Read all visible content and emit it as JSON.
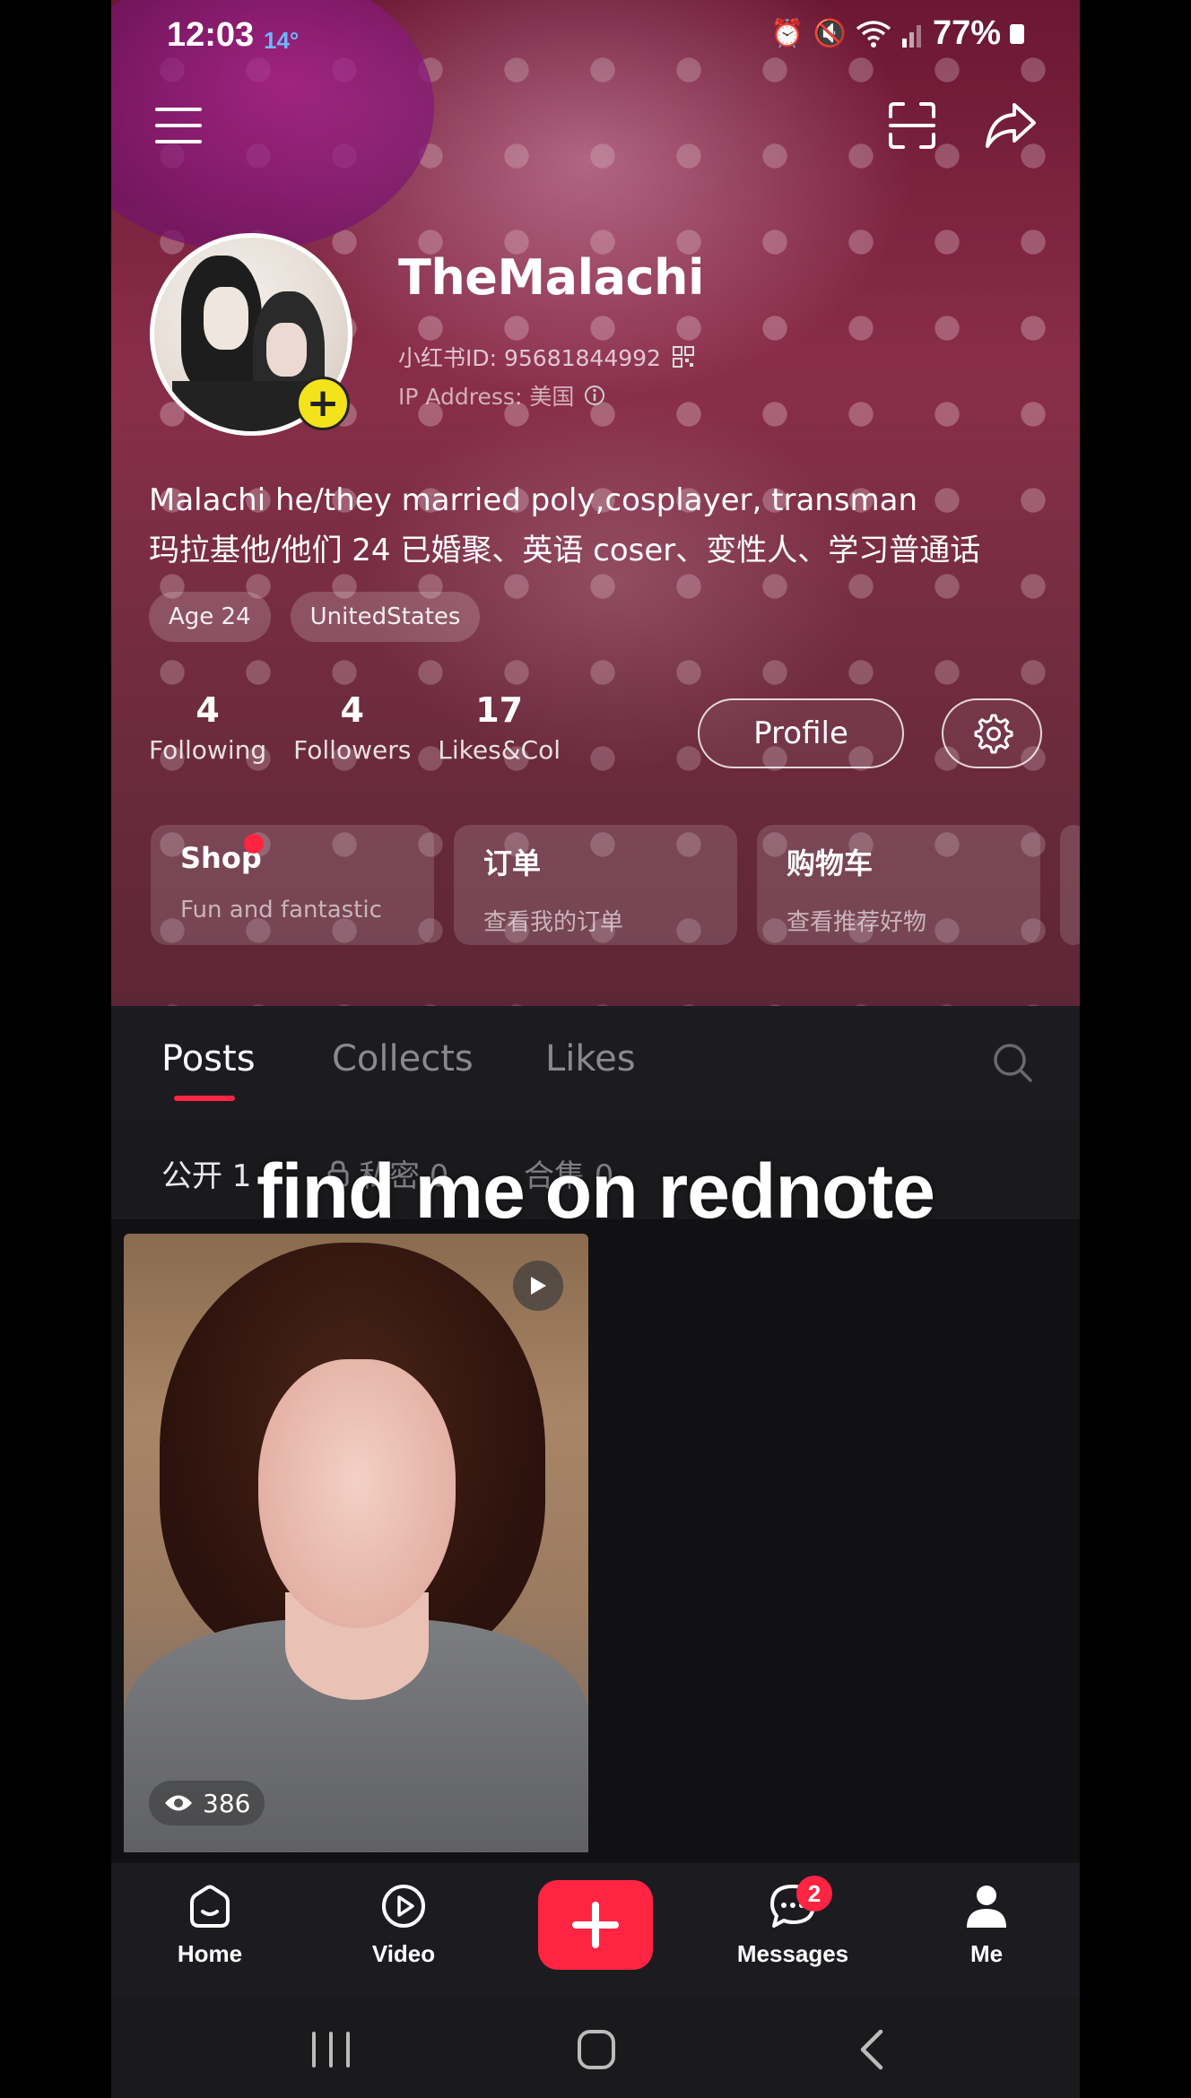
{
  "status": {
    "time": "12:03",
    "temp": "14°",
    "battery": "77%"
  },
  "profile": {
    "name": "TheMalachi",
    "id_text": "小红书ID: 95681844992",
    "ip_text": "IP Address: 美国",
    "bio_line1": "Malachi he/they married poly,cosplayer, transman",
    "bio_line2": "玛拉基他/他们 24 已婚聚、英语 coser、变性人、学习普通话",
    "tags": [
      "Age 24",
      "UnitedStates"
    ]
  },
  "stats": [
    {
      "num": "4",
      "label": "Following"
    },
    {
      "num": "4",
      "label": "Followers"
    },
    {
      "num": "17",
      "label": "Likes&Col"
    }
  ],
  "buttons": {
    "profile": "Profile"
  },
  "cards": [
    {
      "title": "Shop",
      "subtitle": "Fun and fantastic"
    },
    {
      "title": "订单",
      "subtitle": "查看我的订单"
    },
    {
      "title": "购物车",
      "subtitle": "查看推荐好物"
    }
  ],
  "tabs": [
    "Posts",
    "Collects",
    "Likes"
  ],
  "subtabs": [
    "公开 1",
    "私密 0",
    "合集 0"
  ],
  "overlay_caption": "find me on rednote",
  "post": {
    "views": "386"
  },
  "nav": {
    "home": "Home",
    "video": "Video",
    "messages": "Messages",
    "messages_badge": "2",
    "me": "Me"
  },
  "colors": {
    "accent": "#ff2442",
    "plus_yellow": "#f4e21a"
  }
}
